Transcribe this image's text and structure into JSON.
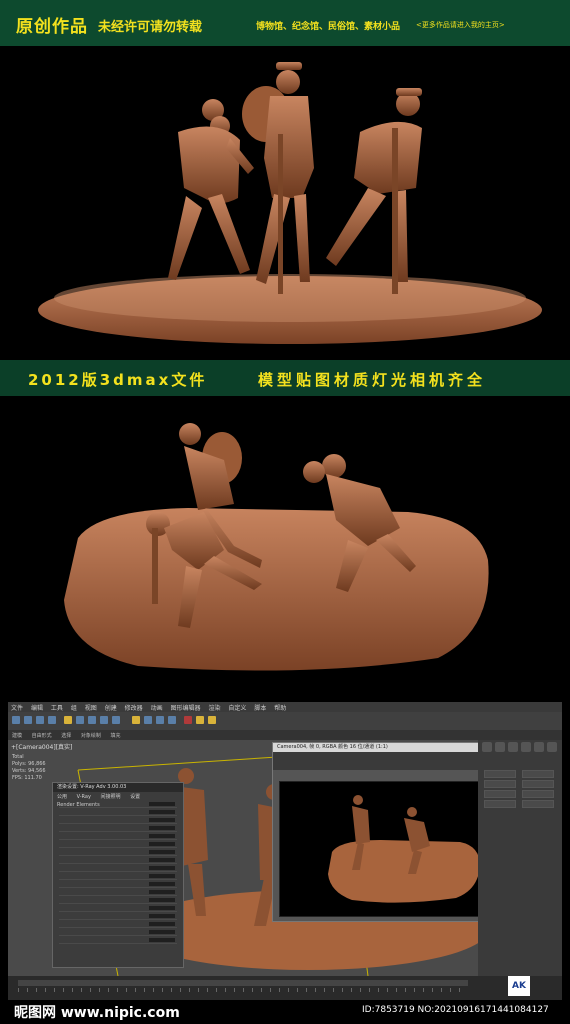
{
  "top_banner": {
    "title": "原创作品",
    "subtitle": "未经许可请勿转载",
    "categories": "博物馆、纪念馆、民俗馆、素材小品",
    "more": "<更多作品请进入我的主页>"
  },
  "mid_banner": {
    "left": "2012版3dmax文件",
    "right": "模型贴图材质灯光相机齐全"
  },
  "app": {
    "menu": [
      "文件",
      "编辑",
      "工具",
      "组",
      "视图",
      "创建",
      "修改器",
      "动画",
      "图形编辑器",
      "渲染",
      "自定义",
      "脚本",
      "帮助"
    ],
    "ribbon": [
      "建模",
      "自由形式",
      "选择",
      "对象绘制",
      "填充"
    ],
    "viewport_label": "+[Camera004][真实]",
    "viewport_stats": [
      "Total",
      "Polys: 96,866",
      "Verts: 94,566",
      "FPS: 111.70"
    ],
    "dialog_title": "渲染设置: V-Ray Adv 3.00.03",
    "dialog_tabs": [
      "公用",
      "V-Ray",
      "间接照明",
      "设置",
      "Render Elements"
    ],
    "framebuffer_title": "Camera004, 帧 0, RGBA 颜色 16 位/通道 (1:1)",
    "logo": "AK"
  },
  "watermark": {
    "site": "昵图网 www.nipic.com",
    "id": "ID:7853719 NO:20210916171441084127"
  },
  "colors": {
    "banner_bg": "#0d4a2e",
    "banner_text": "#f3e11e",
    "bronze": "#a8643d"
  }
}
